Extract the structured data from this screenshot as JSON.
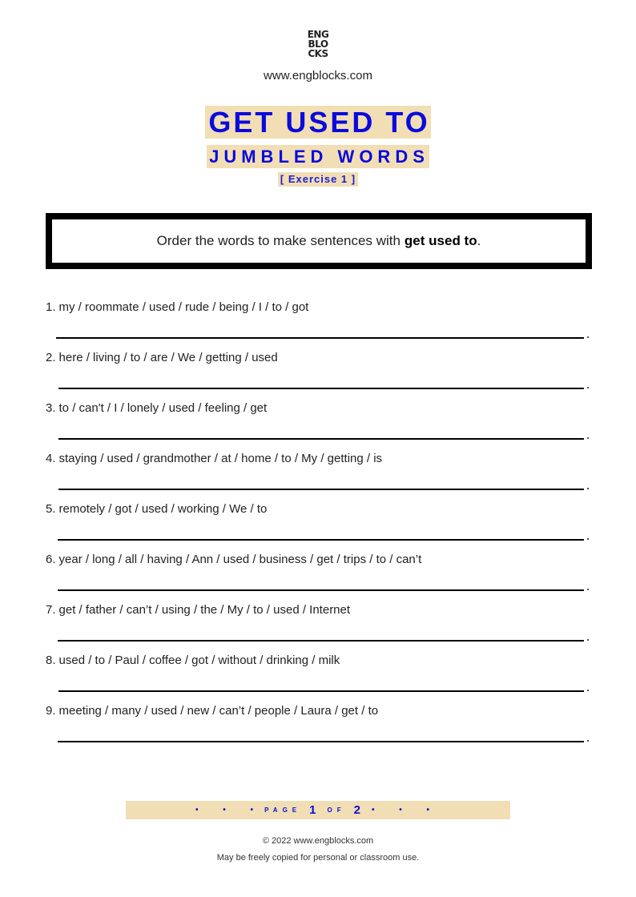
{
  "header": {
    "logo_lines": [
      "ENG",
      "BLO",
      "CKS"
    ],
    "website": "www.engblocks.com"
  },
  "title": {
    "main": "GET USED TO",
    "subtitle": "JUMBLED WORDS",
    "exercise": "[ Exercise 1 ]"
  },
  "instructions": {
    "text": "Order the words to make sentences with",
    "bold": "get used to",
    "end": "."
  },
  "questions": [
    {
      "number": "1.",
      "words": "my / roommate / used / rude / being / I / to / got"
    },
    {
      "number": "2.",
      "words": "here / living / to / are / We / getting / used"
    },
    {
      "number": "3.",
      "words": "to / can't / I / lonely / used / feeling / get"
    },
    {
      "number": "4.",
      "words": "staying / used / grandmother / at / home / to / My / getting / is"
    },
    {
      "number": "5.",
      "words": "remotely / got / used / working / We / to"
    },
    {
      "number": "6.",
      "words": "year / long / all / having / Ann / used / business / get / trips / to / can’t"
    },
    {
      "number": "7.",
      "words": "get / father / can’t / using / the / My / to / used / Internet"
    },
    {
      "number": "8.",
      "words": "used / to / Paul / coffee / got / without / drinking / milk"
    },
    {
      "number": "9.",
      "words": "meeting / many / used / new / can’t / people / Laura / get / to"
    }
  ],
  "pagination": {
    "bullets": "• • •",
    "page_label": "PAGE",
    "current": "1",
    "of_label": "OF",
    "total": "2"
  },
  "footer": {
    "copyright": "© 2022 www.engblocks.com",
    "license": "May be freely copied for personal or classroom use."
  },
  "colors": {
    "accent_blue": "#0a0adc",
    "highlight_beige": "#f2deb5"
  }
}
